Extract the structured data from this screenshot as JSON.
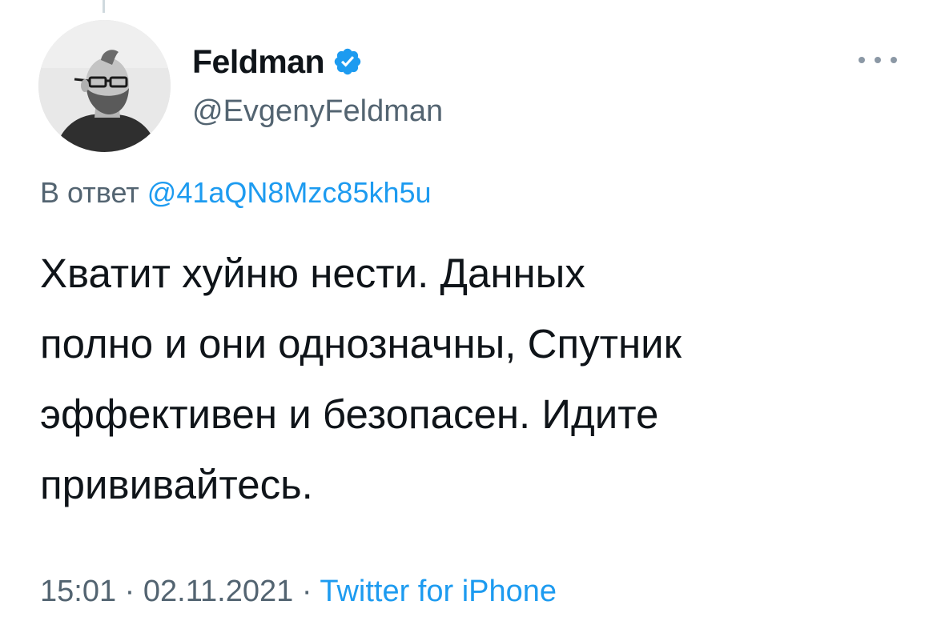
{
  "author": {
    "display_name": "Feldman",
    "handle": "@EvgenyFeldman",
    "verified": true,
    "avatar_icon": "profile-photo"
  },
  "reply": {
    "prefix": "В ответ",
    "mention": "@41aQN8Mzc85kh5u"
  },
  "tweet": {
    "lines": [
      "Хватит хуйню нести. Данных",
      "полно и они однозначны, Спутник",
      "эффективен и безопасен. Идите",
      "прививайтесь."
    ]
  },
  "meta": {
    "time": "15:01",
    "separator": "·",
    "date": "02.11.2021",
    "source": "Twitter for iPhone"
  },
  "colors": {
    "accent": "#1d9bf0",
    "secondary_text": "#536471",
    "primary_text": "#0f1419"
  }
}
